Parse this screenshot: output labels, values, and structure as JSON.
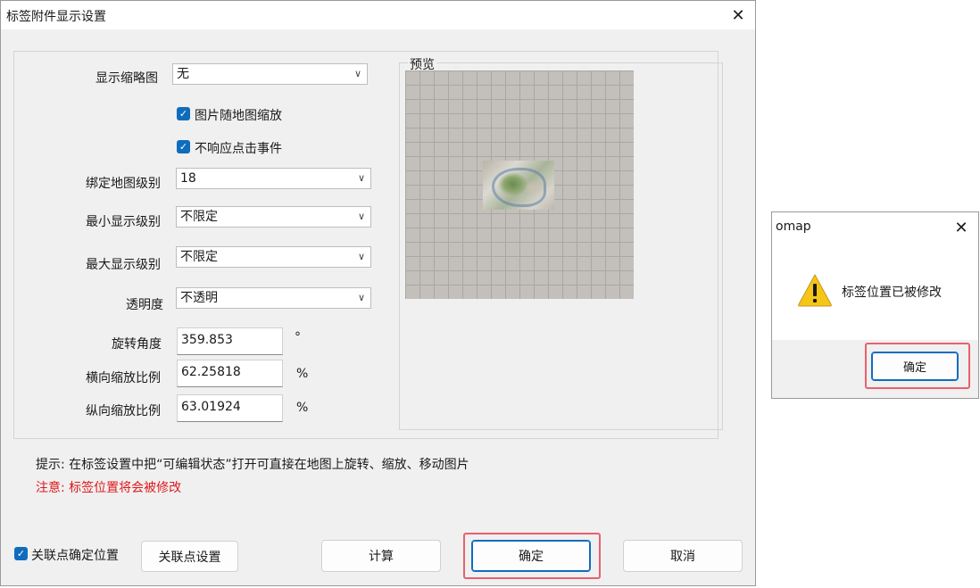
{
  "main_dialog": {
    "title": "标签附件显示设置",
    "close_glyph": "✕",
    "thumbnail": {
      "label": "显示缩略图",
      "value": "无"
    },
    "scale_with_map": {
      "label": "图片随地图缩放",
      "checked": true
    },
    "ignore_click": {
      "label": "不响应点击事件",
      "checked": true
    },
    "bind_level": {
      "label": "绑定地图级别",
      "value": "18"
    },
    "min_level": {
      "label": "最小显示级别",
      "value": "不限定"
    },
    "max_level": {
      "label": "最大显示级别",
      "value": "不限定"
    },
    "opacity": {
      "label": "透明度",
      "value": "不透明"
    },
    "rotation": {
      "label": "旋转角度",
      "value": "359.853",
      "unit": "°"
    },
    "h_scale": {
      "label": "横向缩放比例",
      "value": "62.25818",
      "unit": "%"
    },
    "v_scale": {
      "label": "纵向缩放比例",
      "value": "63.01924",
      "unit": "%"
    },
    "preview_label": "预览",
    "hint": "提示: 在标签设置中把“可编辑状态”打开可直接在地图上旋转、缩放、移动图片",
    "warning": "注意: 标签位置将会被修改",
    "warning_color": "#e0191c",
    "link_position": {
      "label": "关联点确定位置",
      "checked": true
    },
    "buttons": {
      "link_settings": "关联点设置",
      "calculate": "计算",
      "ok": "确定",
      "cancel": "取消"
    }
  },
  "message_box": {
    "title": "omap",
    "close_glyph": "✕",
    "icon": "warning-icon",
    "message": "标签位置已被修改",
    "ok": "确定"
  },
  "accent_color": "#0f6cbd",
  "highlight_color": "#e8606e",
  "combo_arrow": "∨",
  "check_glyph": "✓"
}
